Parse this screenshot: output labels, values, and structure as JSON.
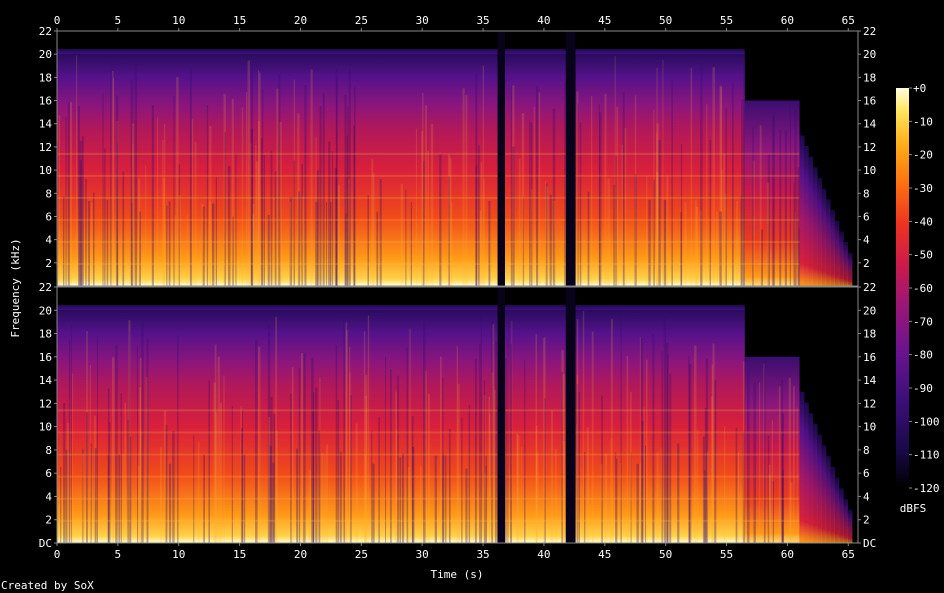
{
  "chart_data": {
    "type": "heatmap",
    "title": "",
    "xlabel": "Time (s)",
    "ylabel": "Frequency (kHz)",
    "x_ticks": [
      "0",
      "5",
      "10",
      "15",
      "20",
      "25",
      "30",
      "35",
      "40",
      "45",
      "50",
      "55",
      "60",
      "65"
    ],
    "x_range": [
      0,
      65.8
    ],
    "y_range": [
      0,
      22
    ],
    "y_ticks_top": [
      "22",
      "20",
      "18",
      "16",
      "14",
      "12",
      "10",
      "8",
      "6",
      "4",
      "2"
    ],
    "y_ticks_bottom": [
      "22",
      "20",
      "18",
      "16",
      "14",
      "12",
      "10",
      "8",
      "6",
      "4",
      "2",
      "DC"
    ],
    "channels": 2,
    "colorbar": {
      "label": "dBFS",
      "range": [
        -120,
        0
      ],
      "ticks": [
        "+0",
        "-10",
        "-20",
        "-30",
        "-40",
        "-50",
        "-60",
        "-70",
        "-80",
        "-90",
        "-100",
        "-110",
        "-120"
      ]
    },
    "segments": [
      {
        "start": 0,
        "end": 36.2,
        "level": "loud",
        "highcut_khz": 20
      },
      {
        "start": 36.2,
        "end": 36.8,
        "level": "silence",
        "highcut_khz": 0
      },
      {
        "start": 36.8,
        "end": 41.8,
        "level": "loud",
        "highcut_khz": 20
      },
      {
        "start": 41.8,
        "end": 42.6,
        "level": "silence",
        "highcut_khz": 0
      },
      {
        "start": 42.6,
        "end": 56.5,
        "level": "loud",
        "highcut_khz": 20
      },
      {
        "start": 56.5,
        "end": 61,
        "level": "medium",
        "highcut_khz": 16
      },
      {
        "start": 61,
        "end": 65.3,
        "level": "fade",
        "highcut_khz": 13
      }
    ]
  },
  "footer": "Created by SoX",
  "colors": {
    "background": "#000000",
    "axis": "#888888",
    "text": "#ffffff",
    "palette": [
      "#000000",
      "#1a0a4a",
      "#3b0f7a",
      "#6a138f",
      "#9b1677",
      "#cc1b4a",
      "#ee3320",
      "#ff7010",
      "#ffae1a",
      "#ffe45a",
      "#ffffe0"
    ]
  }
}
